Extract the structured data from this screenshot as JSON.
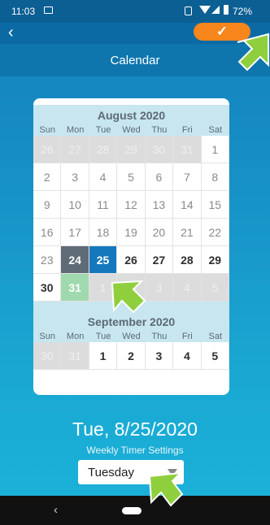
{
  "status_bar": {
    "time": "11:03",
    "battery": "72%"
  },
  "toolbar": {
    "back_glyph": "‹",
    "confirm_glyph": "✓"
  },
  "title": "Calendar",
  "calendar": {
    "weekdays": [
      "Sun",
      "Mon",
      "Tue",
      "Wed",
      "Thu",
      "Fri",
      "Sat"
    ],
    "months": [
      {
        "name": "August 2020",
        "weeks": [
          [
            "26",
            "27",
            "28",
            "29",
            "30",
            "31",
            "1"
          ],
          [
            "2",
            "3",
            "4",
            "5",
            "6",
            "7",
            "8"
          ],
          [
            "9",
            "10",
            "11",
            "12",
            "13",
            "14",
            "15"
          ],
          [
            "16",
            "17",
            "18",
            "19",
            "20",
            "21",
            "22"
          ],
          [
            "23",
            "24",
            "25",
            "26",
            "27",
            "28",
            "29"
          ],
          [
            "30",
            "31",
            "1",
            "2",
            "3",
            "4",
            "5"
          ]
        ],
        "today": "24",
        "selected": "25",
        "highlight": "31"
      },
      {
        "name": "September 2020",
        "weeks": [
          [
            "30",
            "31",
            "1",
            "2",
            "3",
            "4",
            "5"
          ]
        ]
      }
    ]
  },
  "selected_date": "Tue, 8/25/2020",
  "subtitle": "Weekly Timer Settings",
  "dropdown_value": "Tuesday",
  "nav": {
    "back_glyph": "‹"
  },
  "colors": {
    "accent": "#f7861d",
    "selected": "#1578bd",
    "today": "#5f6b76",
    "highlight": "#9fd9ad",
    "pointer": "#8fcf3e"
  }
}
